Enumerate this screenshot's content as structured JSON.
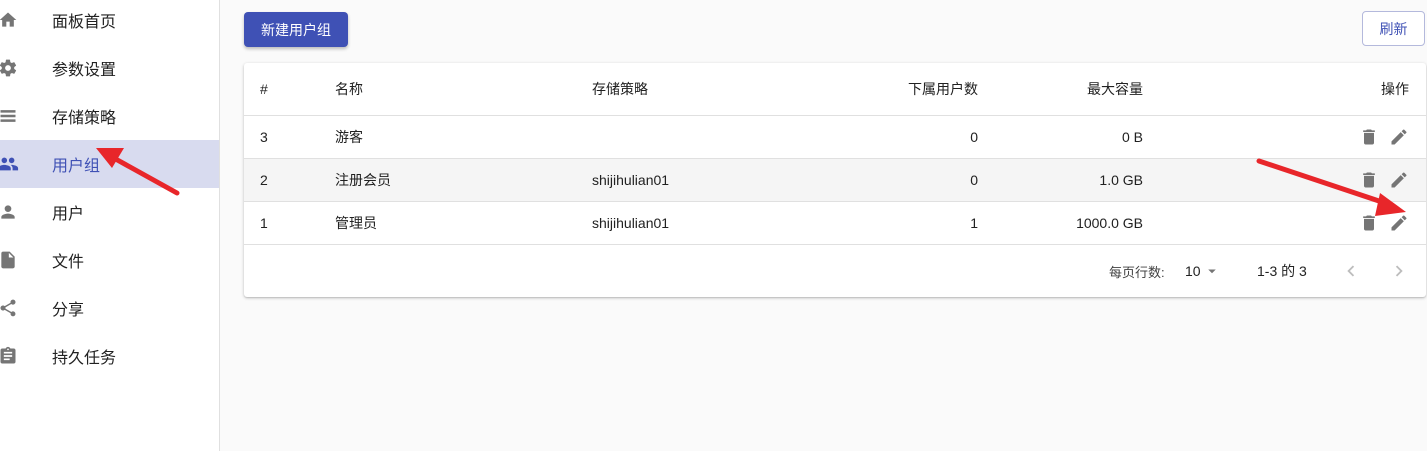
{
  "sidebar": {
    "items": [
      {
        "label": "面板首页",
        "icon": "home-icon"
      },
      {
        "label": "参数设置",
        "icon": "gear-icon"
      },
      {
        "label": "存储策略",
        "icon": "list-icon"
      },
      {
        "label": "用户组",
        "icon": "people-icon",
        "active": true
      },
      {
        "label": "用户",
        "icon": "person-icon"
      },
      {
        "label": "文件",
        "icon": "file-icon"
      },
      {
        "label": "分享",
        "icon": "share-icon"
      },
      {
        "label": "持久任务",
        "icon": "clipboard-icon"
      }
    ]
  },
  "toolbar": {
    "new_label": "新建用户组",
    "refresh_label": "刷新"
  },
  "table": {
    "headers": {
      "id": "#",
      "name": "名称",
      "policy": "存储策略",
      "users": "下属用户数",
      "capacity": "最大容量",
      "ops": "操作"
    },
    "rows": [
      {
        "id": "3",
        "name": "游客",
        "policy": "",
        "users": "0",
        "capacity": "0 B"
      },
      {
        "id": "2",
        "name": "注册会员",
        "policy": "shijihulian01",
        "users": "0",
        "capacity": "1.0 GB"
      },
      {
        "id": "1",
        "name": "管理员",
        "policy": "shijihulian01",
        "users": "1",
        "capacity": "1000.0 GB"
      }
    ]
  },
  "pagination": {
    "rows_per_page_label": "每页行数:",
    "rows_per_page_value": "10",
    "range_text": "1-3 的 3"
  },
  "colors": {
    "primary": "#3f51b5",
    "active_bg": "#d8dbef",
    "annotation_arrow": "#e8262a"
  }
}
